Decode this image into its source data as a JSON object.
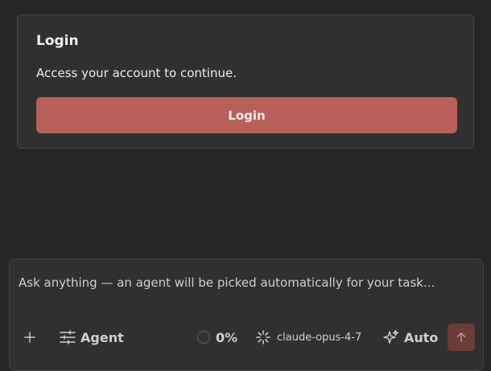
{
  "login": {
    "title": "Login",
    "description": "Access your account to continue.",
    "button_label": "Login"
  },
  "composer": {
    "placeholder": "Ask anything — an agent will be picked automatically for your task...",
    "toolbar": {
      "add_icon": "plus-icon",
      "agent_icon": "sliders-icon",
      "agent_label": "Agent",
      "progress_icon": "progress-ring-icon",
      "progress_value": "0%",
      "model_icon": "loading-spinner-icon",
      "model_name": "claude-opus-4-7",
      "auto_icon": "sparkle-icon",
      "auto_label": "Auto",
      "send_icon": "arrow-up-icon"
    }
  },
  "colors": {
    "background": "#262626",
    "card": "#303030",
    "accent": "#b7605a",
    "send_disabled": "#6b3c38"
  }
}
